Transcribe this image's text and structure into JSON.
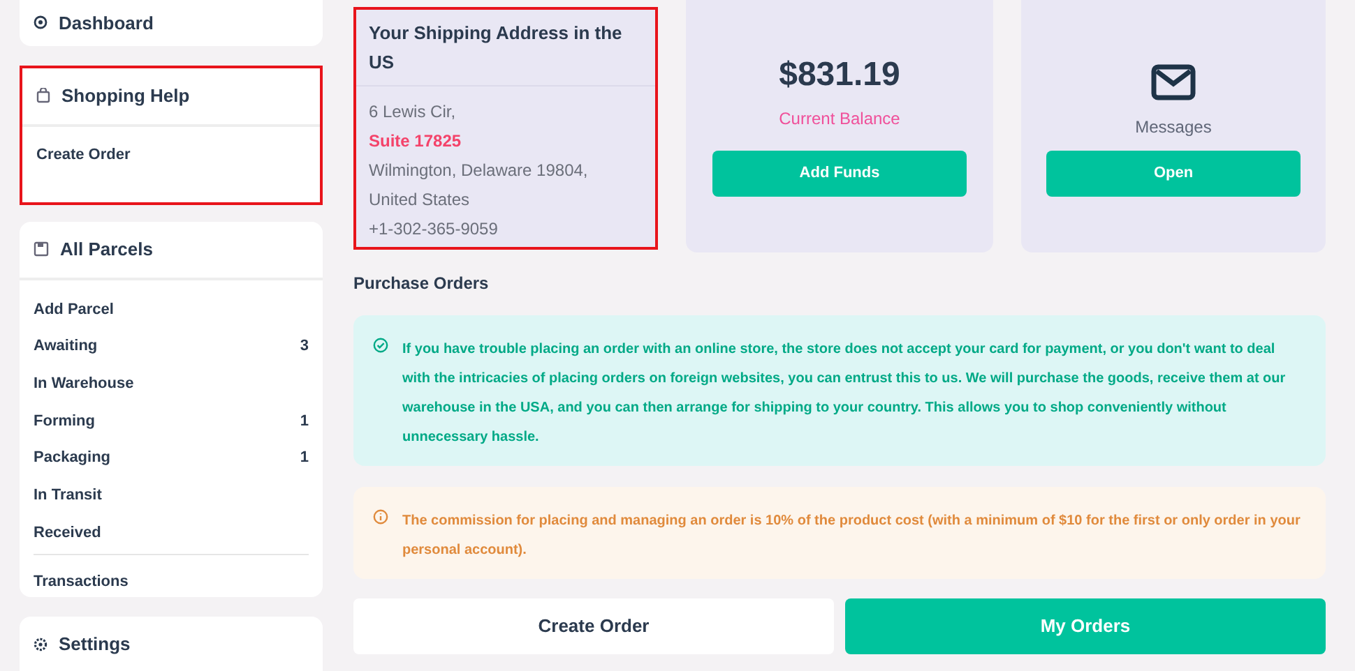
{
  "sidebar": {
    "dashboard": {
      "label": "Dashboard"
    },
    "shopping_help": {
      "title": "Shopping Help",
      "highlighted": true,
      "items": [
        "Create Order"
      ]
    },
    "all_parcels": {
      "title": "All Parcels",
      "items": [
        {
          "label": "Add Parcel"
        },
        {
          "label": "Awaiting",
          "count": "3"
        },
        {
          "label": "In Warehouse"
        },
        {
          "label": "Forming",
          "count": "1"
        },
        {
          "label": "Packaging",
          "count": "1"
        },
        {
          "label": "In Transit"
        },
        {
          "label": "Received"
        }
      ],
      "footer_item": "Transactions"
    },
    "settings": {
      "label": "Settings"
    }
  },
  "address_card": {
    "title": "Your Shipping Address in the US",
    "highlighted": true,
    "lines": [
      {
        "text": "6 Lewis Cir,",
        "kind": "plain"
      },
      {
        "text": "Suite 17825",
        "kind": "accent"
      },
      {
        "text": "Wilmington, Delaware 19804,",
        "kind": "plain"
      },
      {
        "text": "United States",
        "kind": "plain"
      },
      {
        "text": "+1-302-365-9059",
        "kind": "plain"
      }
    ]
  },
  "balance_card": {
    "amount": "$831.19",
    "label": "Current Balance",
    "button": "Add Funds"
  },
  "messages_card": {
    "label": "Messages",
    "button": "Open"
  },
  "purchase_orders": {
    "title": "Purchase Orders",
    "info_note": "If you have trouble placing an order with an online store, the store does not accept your card for payment, or you don't want to deal with the intricacies of placing orders on foreign websites, you can entrust this to us. We will purchase the goods, receive them at our warehouse in the USA, and you can then arrange for shipping to your country. This allows you to shop conveniently without unnecessary hassle.",
    "warning_note": "The commission for placing and managing an order is 10% of the product cost (with a minimum of $10 for the first or only order in your personal account).",
    "buttons": [
      {
        "label": "Create Order",
        "kind": "secondary"
      },
      {
        "label": "My Orders",
        "kind": "primary"
      }
    ]
  }
}
